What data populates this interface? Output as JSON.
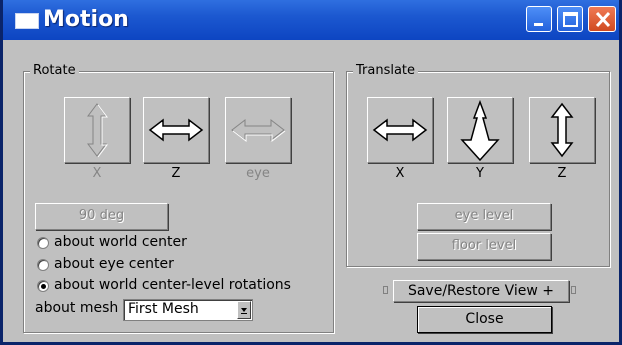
{
  "window": {
    "title": "Motion",
    "controls": [
      "minimize-icon",
      "maximize-icon",
      "close-icon"
    ],
    "colors": {
      "titlebar": "#1c58d0",
      "close": "#d04a20",
      "face": "#c0c0c0"
    }
  },
  "rotate": {
    "group_label": "Rotate",
    "axes": [
      {
        "label": "X",
        "icon": "vertical-double-arrow-icon",
        "enabled": false
      },
      {
        "label": "Z",
        "icon": "horizontal-double-arrow-icon",
        "enabled": true
      },
      {
        "label": "eye",
        "icon": "horizontal-double-arrow-icon",
        "enabled": false
      }
    ],
    "deg_button": "90 deg",
    "radios": [
      {
        "label": "about world center",
        "checked": false
      },
      {
        "label": "about eye center",
        "checked": false
      },
      {
        "label": "about world center-level rotations",
        "checked": true
      }
    ],
    "mesh_label": "about mesh",
    "mesh_value": "First Mesh"
  },
  "translate": {
    "group_label": "Translate",
    "axes": [
      {
        "label": "X",
        "icon": "horizontal-double-arrow-icon",
        "enabled": true
      },
      {
        "label": "Y",
        "icon": "perspective-arrow-icon",
        "enabled": true
      },
      {
        "label": "Z",
        "icon": "vertical-double-arrow-icon",
        "enabled": true
      }
    ],
    "eye_level": "eye level",
    "floor_level": "floor level"
  },
  "bottom": {
    "save_restore": "Save/Restore View +",
    "close": "Close"
  }
}
